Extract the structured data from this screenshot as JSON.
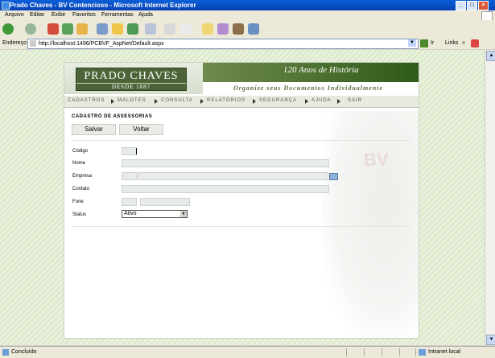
{
  "window": {
    "title": "Prado Chaves - BV Contencioso - Microsoft Internet Explorer",
    "minimize_label": "_",
    "maximize_label": "□",
    "close_label": "×"
  },
  "menubar": {
    "items": [
      "Arquivo",
      "Editar",
      "Exibir",
      "Favoritos",
      "Ferramentas",
      "Ajuda"
    ]
  },
  "addressbar": {
    "label": "Endereço",
    "url": "http://localhost:1496/PCBVF_AspNet/Default.aspx",
    "dropdown_glyph": "▼",
    "go_label": "Ir",
    "links_label": "Links",
    "chevron": "»"
  },
  "header": {
    "logo_name": "PRADO CHAVES",
    "logo_since": "DESDE 1887",
    "banner_title": "120 Anos de História",
    "banner_subtitle": "Organize seus Documentos Individualmente"
  },
  "nav": {
    "items": [
      "CADASTROS",
      "MALOTES",
      "CONSULTA",
      "RELATÓRIOS",
      "SEGURANÇA",
      "AJUDA",
      "SAIR"
    ]
  },
  "form": {
    "section_title": "CADASTRO DE ASSESSORIAS",
    "save_label": "Salvar",
    "back_label": "Voltar",
    "labels": {
      "codigo": "Código",
      "nome": "Nome",
      "empresa": "Empresa",
      "contato": "Contato",
      "fone": "Fone",
      "status": "Status"
    },
    "status_value": "Ativo",
    "status_arrow": "▼"
  },
  "watermark": {
    "text": "BV"
  },
  "statusbar": {
    "message": "Concluído",
    "zone": "Intranet local"
  },
  "scroll": {
    "up": "▲",
    "down": "▼"
  }
}
